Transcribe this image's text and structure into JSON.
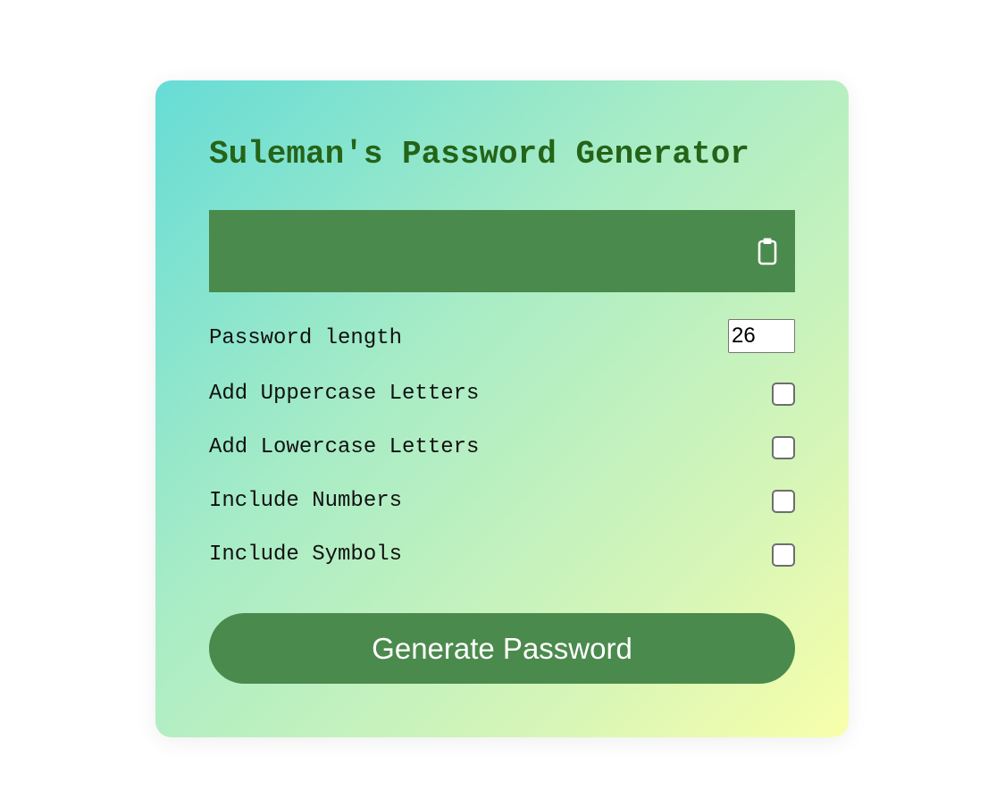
{
  "app": {
    "title": "Suleman's Password Generator"
  },
  "result": {
    "password": "",
    "copy_icon": "clipboard-icon"
  },
  "settings": {
    "length_label": "Password length",
    "length_value": "26",
    "options": [
      {
        "label": "Add Uppercase Letters",
        "checked": false
      },
      {
        "label": "Add Lowercase Letters",
        "checked": false
      },
      {
        "label": "Include Numbers",
        "checked": false
      },
      {
        "label": "Include Symbols",
        "checked": false
      }
    ]
  },
  "generate_label": "Generate Password",
  "colors": {
    "accent": "#4b8a4d",
    "title": "#256418",
    "gradient_start": "#66dcd6",
    "gradient_end": "#f8ffab"
  }
}
